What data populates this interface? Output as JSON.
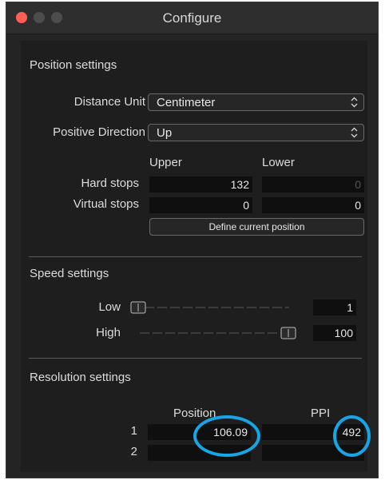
{
  "window": {
    "title": "Configure",
    "traffic_lights": [
      "#ff5f57",
      "#4d4d4d",
      "#4d4d4d"
    ]
  },
  "position": {
    "heading": "Position settings",
    "distance_unit_label": "Distance Unit",
    "distance_unit_value": "Centimeter",
    "positive_direction_label": "Positive Direction",
    "positive_direction_value": "Up",
    "upper_header": "Upper",
    "lower_header": "Lower",
    "hard_stops_label": "Hard stops",
    "hard_stops_upper": "132",
    "hard_stops_lower": "0",
    "virtual_stops_label": "Virtual stops",
    "virtual_stops_upper": "0",
    "virtual_stops_lower": "0",
    "define_button": "Define current position"
  },
  "speed": {
    "heading": "Speed settings",
    "low_label": "Low",
    "low_value": "1",
    "high_label": "High",
    "high_value": "100"
  },
  "resolution": {
    "heading": "Resolution settings",
    "position_header": "Position",
    "ppi_header": "PPI",
    "rows": [
      {
        "index": "1",
        "position": "106.09",
        "ppi": "492"
      },
      {
        "index": "2",
        "position": "",
        "ppi": ""
      }
    ]
  },
  "highlight_color": "#17a5e6"
}
